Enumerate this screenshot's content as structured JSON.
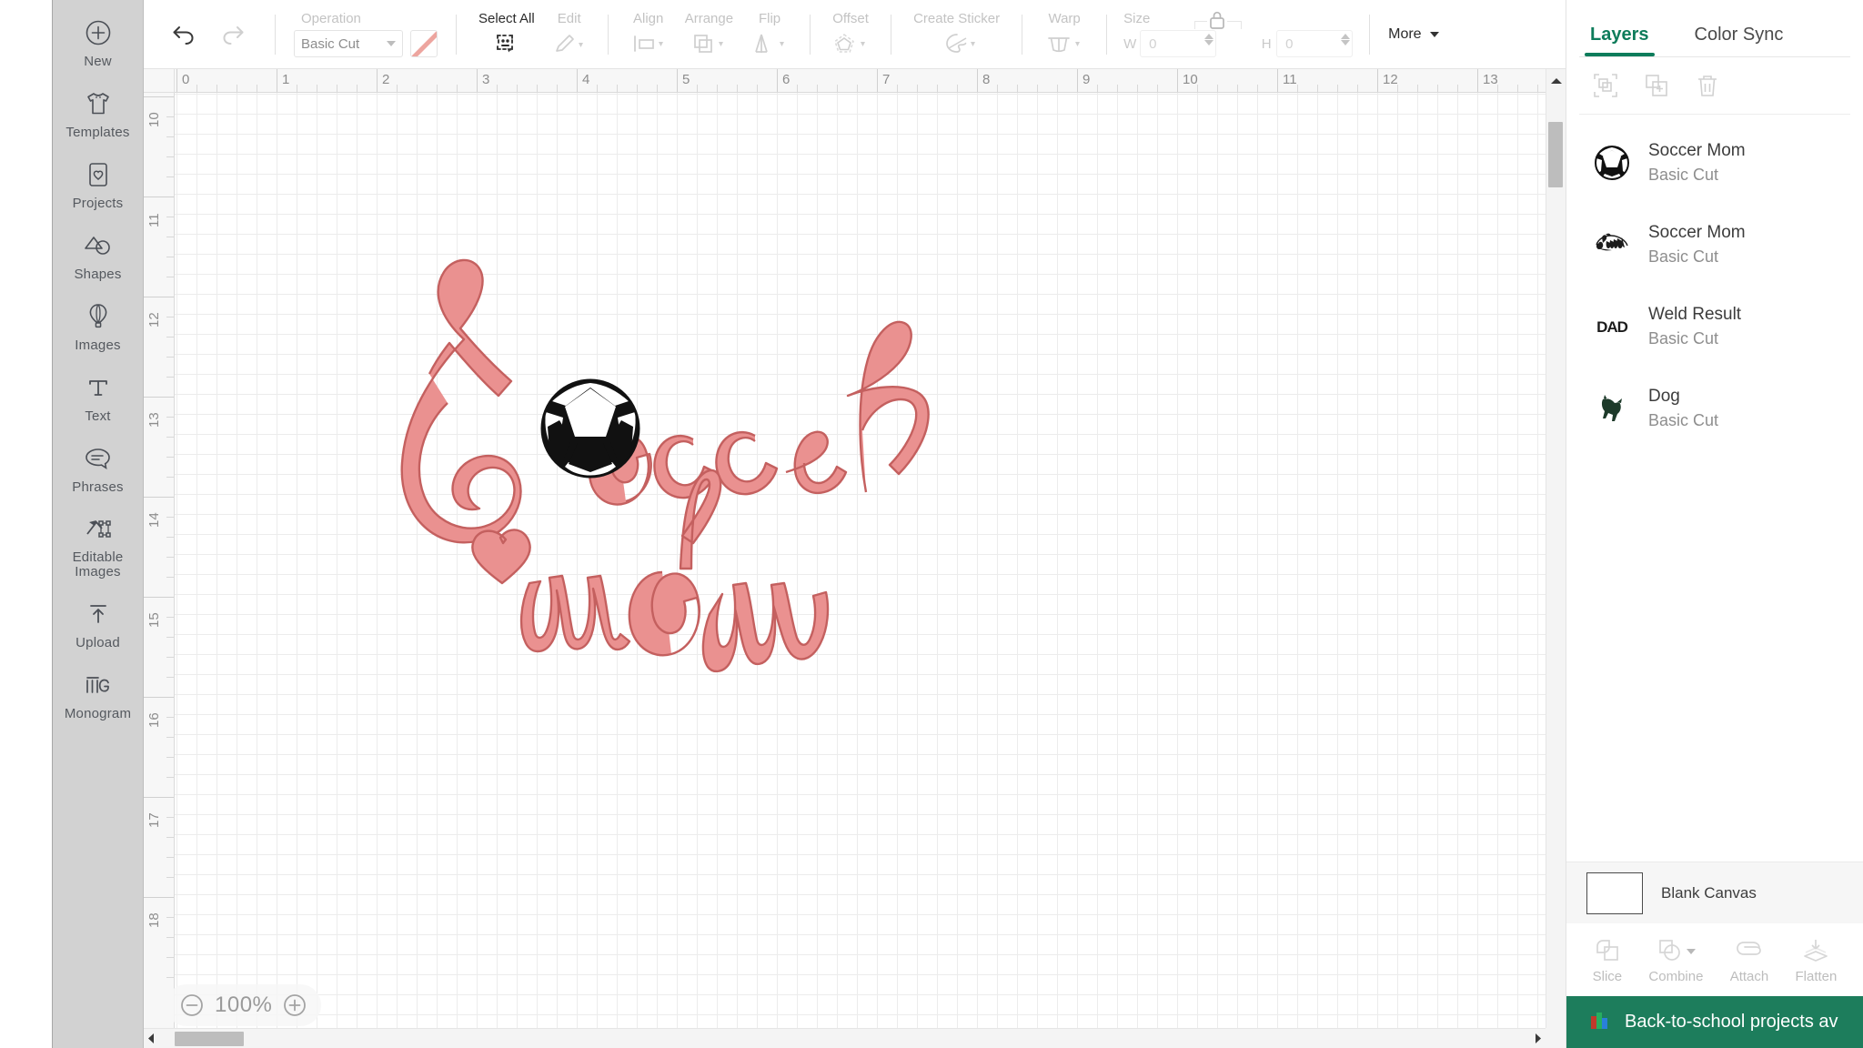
{
  "left_nav": {
    "items": [
      {
        "label": "New",
        "icon": "plus-circle-icon"
      },
      {
        "label": "Templates",
        "icon": "tshirt-icon"
      },
      {
        "label": "Projects",
        "icon": "card-heart-icon"
      },
      {
        "label": "Shapes",
        "icon": "shapes-icon"
      },
      {
        "label": "Images",
        "icon": "hot-air-balloon-icon"
      },
      {
        "label": "Text",
        "icon": "text-t-icon"
      },
      {
        "label": "Phrases",
        "icon": "speech-bubble-icon"
      },
      {
        "label": "Editable Images",
        "icon": "editable-images-icon"
      },
      {
        "label": "Upload",
        "icon": "upload-arrow-icon"
      },
      {
        "label": "Monogram",
        "icon": "monogram-icon"
      }
    ]
  },
  "toolbar": {
    "undo": "undo-icon",
    "redo": "redo-icon",
    "operation_label": "Operation",
    "operation_value": "Basic Cut",
    "operation_color": "#eda59f",
    "select_all_label": "Select All",
    "edit_label": "Edit",
    "align_label": "Align",
    "arrange_label": "Arrange",
    "flip_label": "Flip",
    "offset_label": "Offset",
    "create_sticker_label": "Create Sticker",
    "warp_label": "Warp",
    "size_label": "Size",
    "width_prefix": "W",
    "width_value": "0",
    "height_prefix": "H",
    "height_value": "0",
    "more_label": "More"
  },
  "canvas": {
    "zoom_level": "100%",
    "zoom_out_icon": "minus-circle-icon",
    "zoom_in_icon": "plus-circle-icon",
    "ruler_h_labels": [
      "0",
      "1",
      "2",
      "3",
      "4",
      "5",
      "6",
      "7",
      "8",
      "9",
      "10",
      "11",
      "12",
      "13"
    ],
    "ruler_v_labels": [
      "10",
      "11",
      "12",
      "13",
      "14",
      "15",
      "16",
      "17",
      "18"
    ],
    "art": {
      "title": "Soccer Mom",
      "script_fill": "#ea9190",
      "script_stroke": "#c4605f",
      "ball_fill": "#111111"
    }
  },
  "right_panel": {
    "tabs": [
      {
        "label": "Layers",
        "active": true
      },
      {
        "label": "Color Sync",
        "active": false
      }
    ],
    "tools": [
      {
        "name": "group-icon"
      },
      {
        "name": "duplicate-icon"
      },
      {
        "name": "trash-icon"
      }
    ],
    "layers": [
      {
        "name": "Soccer Mom",
        "operation": "Basic Cut",
        "thumb": "soccer-ball-thumb"
      },
      {
        "name": "Soccer Mom",
        "operation": "Basic Cut",
        "thumb": "script-text-thumb"
      },
      {
        "name": "Weld Result",
        "operation": "Basic Cut",
        "thumb": "dad-text-thumb"
      },
      {
        "name": "Dog",
        "operation": "Basic Cut",
        "thumb": "dog-thumb"
      }
    ],
    "canvas_strip": {
      "label": "Blank Canvas",
      "color": "#ffffff"
    },
    "actions": [
      {
        "label": "Slice",
        "icon": "slice-icon"
      },
      {
        "label": "Combine",
        "icon": "combine-icon"
      },
      {
        "label": "Attach",
        "icon": "paperclip-icon"
      },
      {
        "label": "Flatten",
        "icon": "flatten-icon"
      }
    ],
    "promo": {
      "text": "Back-to-school projects av",
      "icon": "books-icon",
      "color": "#1d7d5c"
    }
  }
}
